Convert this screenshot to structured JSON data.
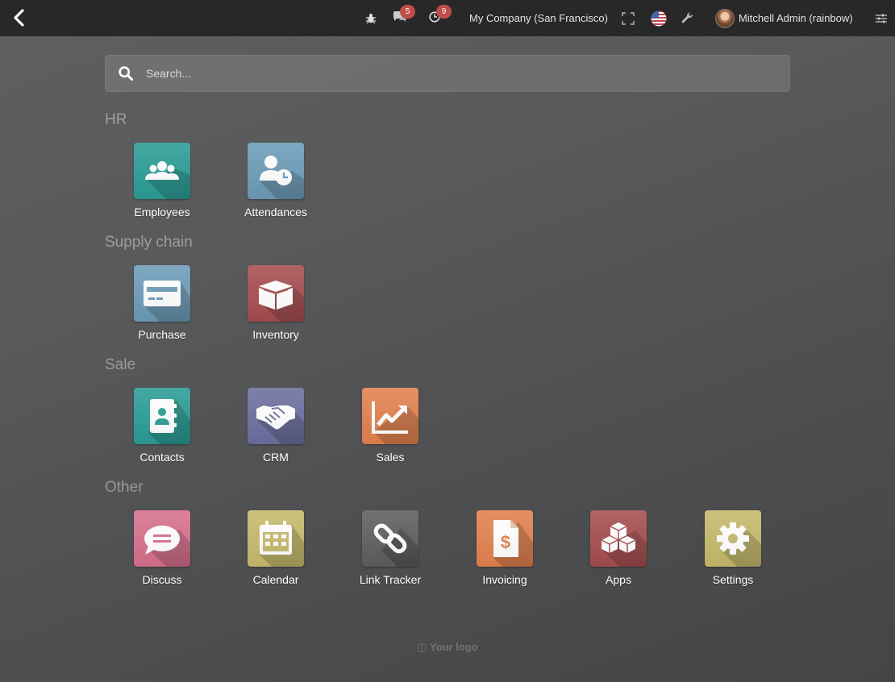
{
  "topbar": {
    "messages_count": "5",
    "activities_count": "9",
    "company": "My Company (San Francisco)",
    "user": "Mitchell Admin (rainbow)"
  },
  "search": {
    "placeholder": "Search..."
  },
  "sections": [
    {
      "title": "HR",
      "apps": [
        {
          "label": "Employees",
          "color": "#2a9d95",
          "icon": "employees-icon"
        },
        {
          "label": "Attendances",
          "color": "#6d9bb8",
          "icon": "attendances-icon"
        }
      ]
    },
    {
      "title": "Supply chain",
      "apps": [
        {
          "label": "Purchase",
          "color": "#6d9bb8",
          "icon": "purchase-icon"
        },
        {
          "label": "Inventory",
          "color": "#a64d4f",
          "icon": "inventory-icon"
        }
      ]
    },
    {
      "title": "Sale",
      "apps": [
        {
          "label": "Contacts",
          "color": "#2a9d95",
          "icon": "contacts-icon"
        },
        {
          "label": "CRM",
          "color": "#6c6f9e",
          "icon": "crm-icon"
        },
        {
          "label": "Sales",
          "color": "#e2814d",
          "icon": "sales-icon"
        }
      ]
    },
    {
      "title": "Other",
      "apps": [
        {
          "label": "Discuss",
          "color": "#d6708d",
          "icon": "discuss-icon"
        },
        {
          "label": "Calendar",
          "color": "#c6ba6c",
          "icon": "calendar-icon"
        },
        {
          "label": "Link Tracker",
          "color": "#5d5e60",
          "icon": "link-tracker-icon"
        },
        {
          "label": "Invoicing",
          "color": "#e2814d",
          "icon": "invoicing-icon"
        },
        {
          "label": "Apps",
          "color": "#a64d4f",
          "icon": "apps-icon"
        },
        {
          "label": "Settings",
          "color": "#c6ba6c",
          "icon": "settings-icon"
        }
      ]
    }
  ],
  "footer": {
    "logo_text": "Your logo"
  }
}
